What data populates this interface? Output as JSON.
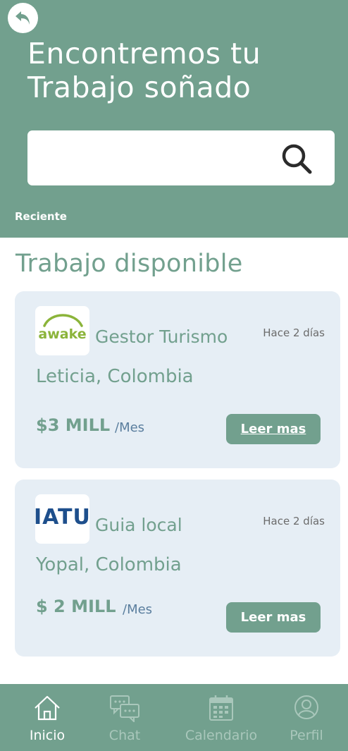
{
  "header": {
    "headline_line1": "Encontremos tu",
    "headline_line2": "Trabajo soñado",
    "search_value": "",
    "recent_label": "Reciente"
  },
  "section_title": "Trabajo disponible",
  "jobs": [
    {
      "logo_text": "awake",
      "title": "Gestor Turismo",
      "posted": "Hace 2 días",
      "location": "Leticia, Colombia",
      "salary": "$3 MILL",
      "period": "/Mes",
      "button": "Leer mas"
    },
    {
      "logo_text": "IATU",
      "title": "Guia local",
      "posted": "Hace 2 días",
      "location": "Yopal, Colombia",
      "salary": "$ 2 MILL",
      "period": "/Mes",
      "button": "Leer mas"
    }
  ],
  "nav": [
    {
      "label": "Inicio",
      "icon": "home-icon",
      "active": true
    },
    {
      "label": "Chat",
      "icon": "chat-icon",
      "active": false
    },
    {
      "label": "Calendario",
      "icon": "calendar-icon",
      "active": false
    },
    {
      "label": "Perfil",
      "icon": "profile-icon",
      "active": false
    }
  ],
  "colors": {
    "primary": "#72a08e",
    "card_bg": "#e6eef5",
    "nav_inactive": "#a9c7bb",
    "period_text": "#5a7e9e",
    "awake_logo": "#8bb43a",
    "iatu_logo": "#1e4f8c"
  }
}
